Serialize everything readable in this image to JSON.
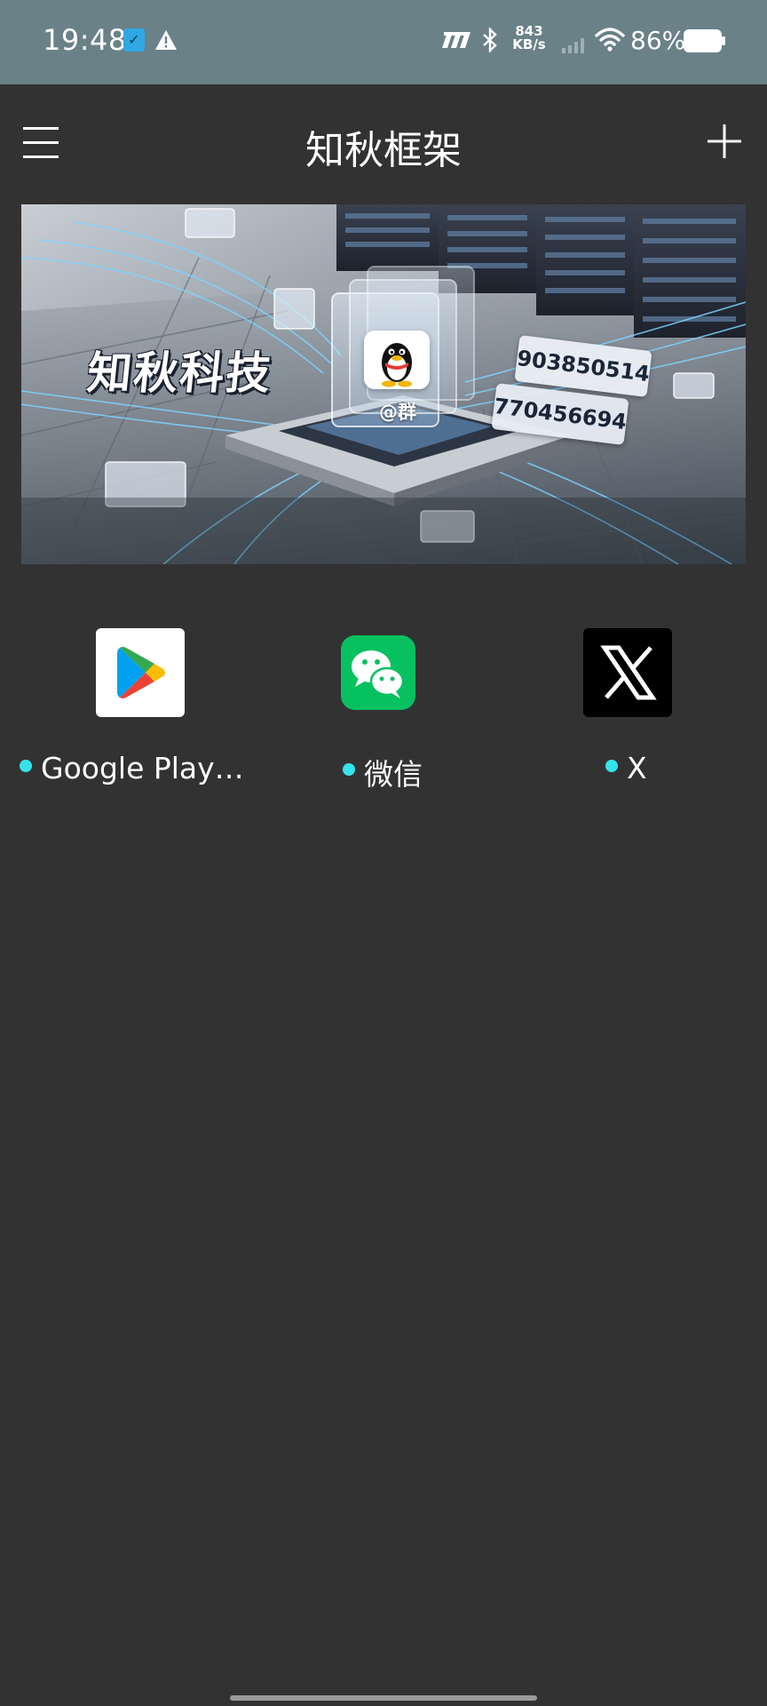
{
  "status_bar": {
    "time": "19:48",
    "net_speed_value": "843",
    "net_speed_unit": "KB/s",
    "battery_percent": "86%",
    "icons": [
      "app-notification-icon",
      "warning-icon",
      "hd-signal-icon",
      "bluetooth-icon",
      "cellular-signal-icon",
      "wifi-icon",
      "battery-icon"
    ]
  },
  "header": {
    "title": "知秋框架",
    "menu_icon": "hamburger-menu-icon",
    "add_icon": "plus-icon"
  },
  "banner": {
    "title": "知秋科技",
    "qq_label": "@群",
    "group_numbers": [
      "903850514",
      "770456694"
    ]
  },
  "apps": [
    {
      "label": "Google Play…",
      "icon": "google-play-icon",
      "status_color": "#35e4ea"
    },
    {
      "label": "微信",
      "icon": "wechat-icon",
      "status_color": "#35e4ea"
    },
    {
      "label": "X",
      "icon": "x-icon",
      "status_color": "#35e4ea"
    }
  ],
  "colors": {
    "status_bar_bg": "#6a8188",
    "page_bg": "#323232",
    "status_dot": "#35e4ea",
    "wechat_green": "#07c160"
  }
}
